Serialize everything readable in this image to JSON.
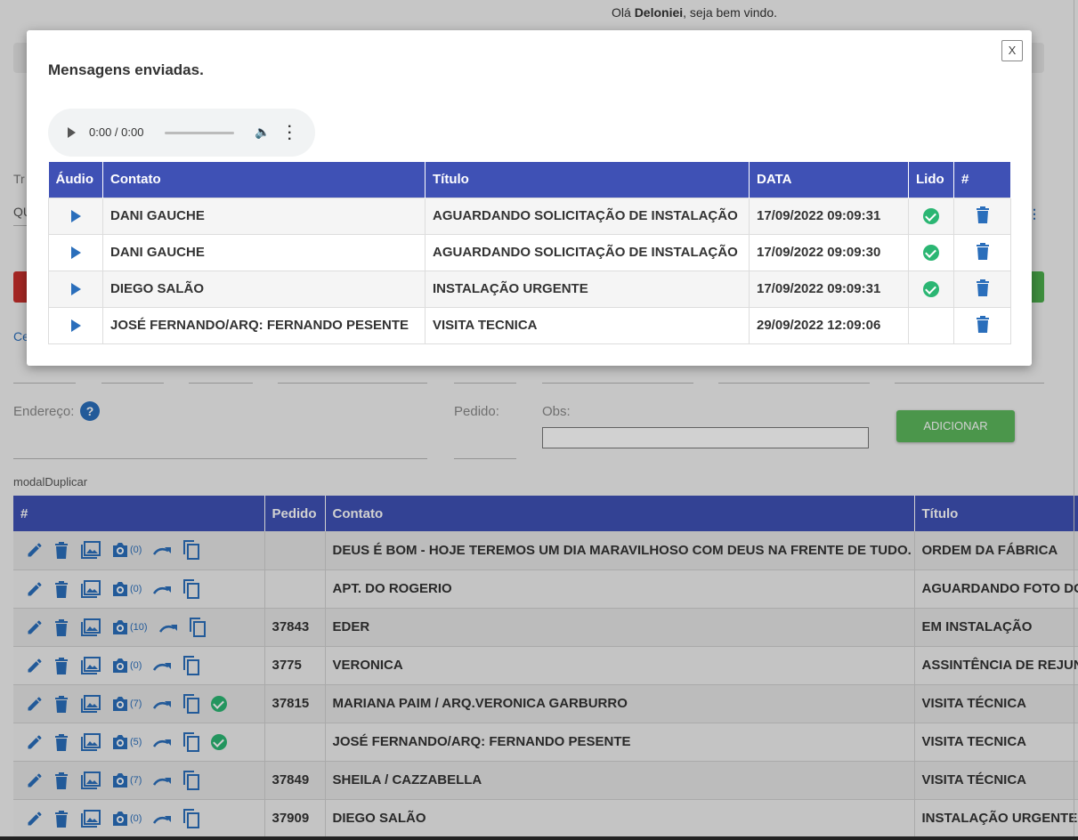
{
  "header": {
    "greeting_prefix": "Olá ",
    "user": "Deloniei",
    "greeting_suffix": ", seja bem vindo."
  },
  "form": {
    "fragment_tr": "Tr",
    "fragment_qu": "QU",
    "fragment_ce": "Ce",
    "address_label": "Endereço:",
    "help_icon": "?",
    "order_label": "Pedido:",
    "obs_label": "Obs:",
    "add_button": "ADICIONAR",
    "modal_duplicate_label": "modalDuplicar"
  },
  "main_table": {
    "headers": [
      "#",
      "Pedido",
      "Contato",
      "Título"
    ],
    "rows": [
      {
        "count": "(0)",
        "order": "",
        "contact": "DEUS É BOM - HOJE TEREMOS UM DIA MARAVILHOSO COM DEUS NA FRENTE DE TUDO.",
        "title": "ORDEM DA FÁBRICA",
        "checked": false
      },
      {
        "count": "(0)",
        "order": "",
        "contact": "APT. DO ROGERIO",
        "title": "AGUARDANDO FOTO DO",
        "checked": false
      },
      {
        "count": "(10)",
        "order": "37843",
        "contact": "EDER",
        "title": "EM INSTALAÇÃO",
        "checked": false
      },
      {
        "count": "(0)",
        "order": "3775",
        "contact": "VERONICA",
        "title": "ASSINTÊNCIA DE REJUN",
        "checked": false
      },
      {
        "count": "(7)",
        "order": "37815",
        "contact": "MARIANA PAIM / ARQ.VERONICA GARBURRO",
        "title": "VISITA TÉCNICA",
        "checked": true
      },
      {
        "count": "(5)",
        "order": "",
        "contact": "JOSÉ FERNANDO/ARQ: FERNANDO PESENTE",
        "title": "VISITA TECNICA",
        "checked": true
      },
      {
        "count": "(7)",
        "order": "37849",
        "contact": "SHEILA / CAZZABELLA",
        "title": "VISITA TÉCNICA",
        "checked": false
      },
      {
        "count": "(0)",
        "order": "37909",
        "contact": "DIEGO SALÃO",
        "title": "INSTALAÇÃO URGENTE",
        "checked": false
      }
    ]
  },
  "modal": {
    "title": "Mensagens enviadas.",
    "close": "X",
    "audio_time": "0:00 / 0:00",
    "headers": [
      "Áudio",
      "Contato",
      "Título",
      "DATA",
      "Lido",
      "#"
    ],
    "rows": [
      {
        "contact": "DANI GAUCHE",
        "title": "AGUARDANDO SOLICITAÇÃO DE INSTALAÇÃO",
        "date": "17/09/2022 09:09:31",
        "read": true
      },
      {
        "contact": "DANI GAUCHE",
        "title": "AGUARDANDO SOLICITAÇÃO DE INSTALAÇÃO",
        "date": "17/09/2022 09:09:30",
        "read": true
      },
      {
        "contact": "DIEGO SALÃO",
        "title": "INSTALAÇÃO URGENTE",
        "date": "17/09/2022 09:09:31",
        "read": true
      },
      {
        "contact": "JOSÉ FERNANDO/ARQ: FERNANDO PESENTE",
        "title": "VISITA TECNICA",
        "date": "29/09/2022 12:09:06",
        "read": false
      }
    ]
  },
  "colors": {
    "header_blue": "#3f51b5",
    "icon_blue": "#2a6ebb",
    "check_green": "#2bb673",
    "add_green": "#5cb85c"
  }
}
